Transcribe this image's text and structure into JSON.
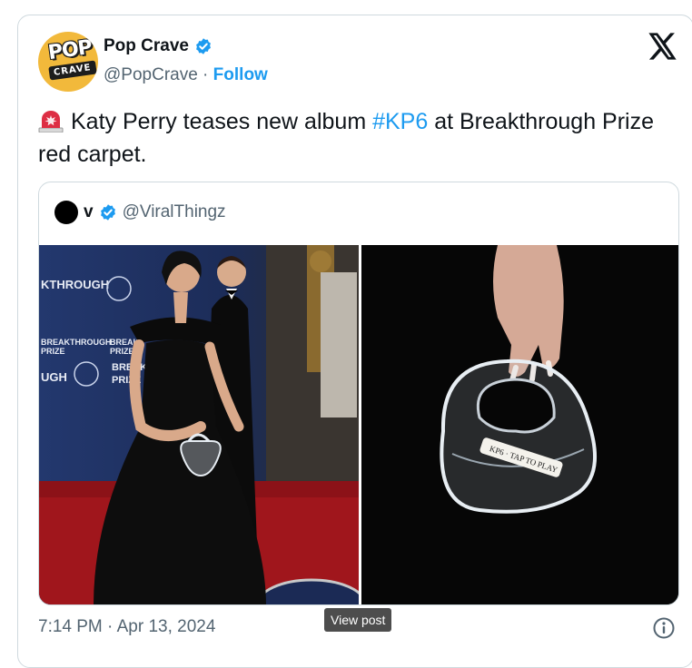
{
  "author": {
    "name": "Pop Crave",
    "handle": "@PopCrave",
    "separator": " · ",
    "follow_label": "Follow",
    "avatar_text_top": "POP",
    "avatar_text_bottom": "CRAVE"
  },
  "tweet": {
    "text_main": "Katy Perry teases new album ",
    "hashtag": "#KP6",
    "text_rest": " at Breakthrough Prize red carpet."
  },
  "quoted": {
    "name": "v",
    "handle": "@ViralThingz"
  },
  "footer": {
    "timestamp": "7:14 PM · Apr 13, 2024",
    "tooltip": "View post"
  },
  "icons": {
    "verified": "verified-badge-icon",
    "platform": "x-logo-icon",
    "siren": "police-light-emoji-icon",
    "info": "info-icon"
  },
  "colors": {
    "accent": "#1d9bf0",
    "text": "#0f1419",
    "secondary": "#536471",
    "border": "#cfd9de"
  }
}
